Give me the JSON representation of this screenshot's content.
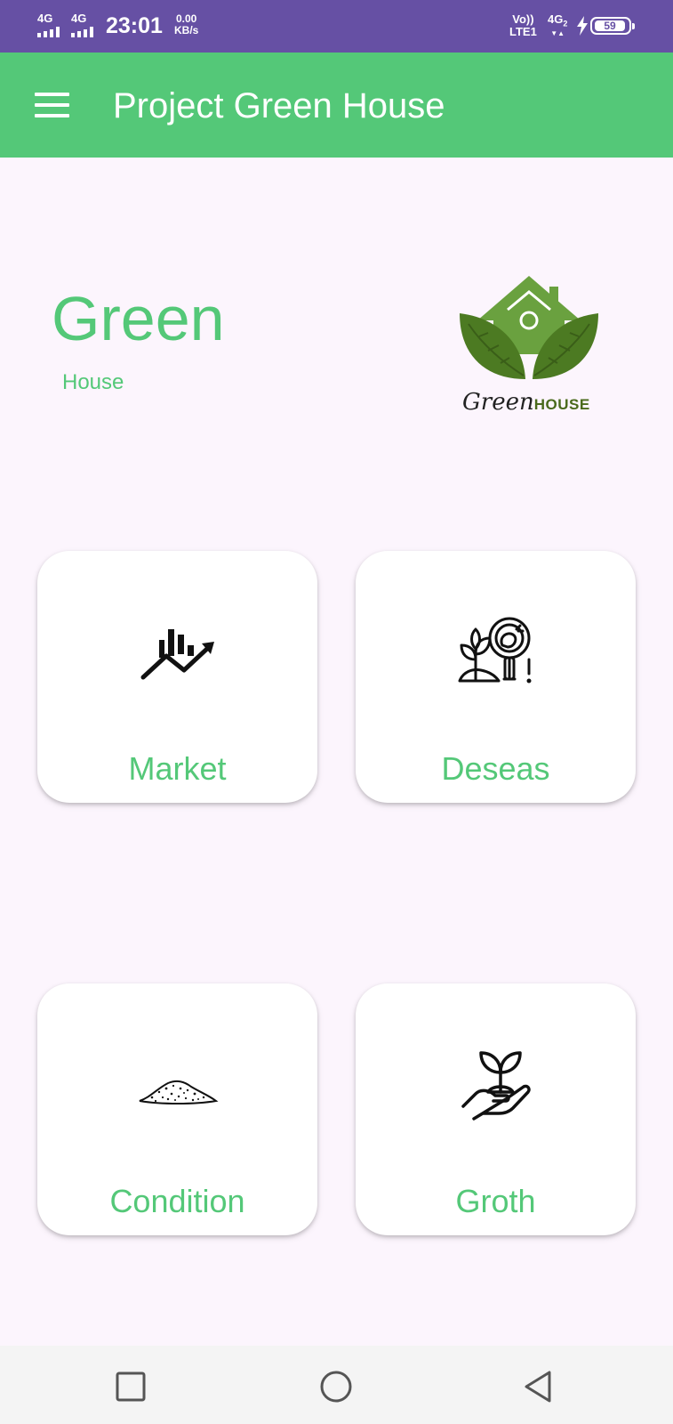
{
  "status_bar": {
    "sim1_network": "4G",
    "sim2_network": "4G",
    "time": "23:01",
    "speed_value": "0.00",
    "speed_unit": "KB/s",
    "volte_top": "Vo))",
    "volte_bottom": "LTE1",
    "network_right": "4G",
    "network_right_sub": "2",
    "battery_level": "59",
    "accent_color": "#6650a4"
  },
  "app_bar": {
    "title": "Project Green House",
    "menu_icon": "hamburger-menu-icon",
    "color": "#54c878"
  },
  "header": {
    "title": "Green",
    "subtitle": "House",
    "logo_script": "Green",
    "logo_bold": "HOUSE"
  },
  "cards": [
    {
      "label": "Market",
      "icon": "chart-trend-up-icon"
    },
    {
      "label": "Deseas",
      "icon": "plant-disease-magnifier-icon"
    },
    {
      "label": "Condition",
      "icon": "soil-pile-icon"
    },
    {
      "label": "Groth",
      "icon": "hand-sprout-icon"
    }
  ],
  "nav_bar": {
    "recent": "square-recents-icon",
    "home": "circle-home-icon",
    "back": "triangle-back-icon"
  }
}
